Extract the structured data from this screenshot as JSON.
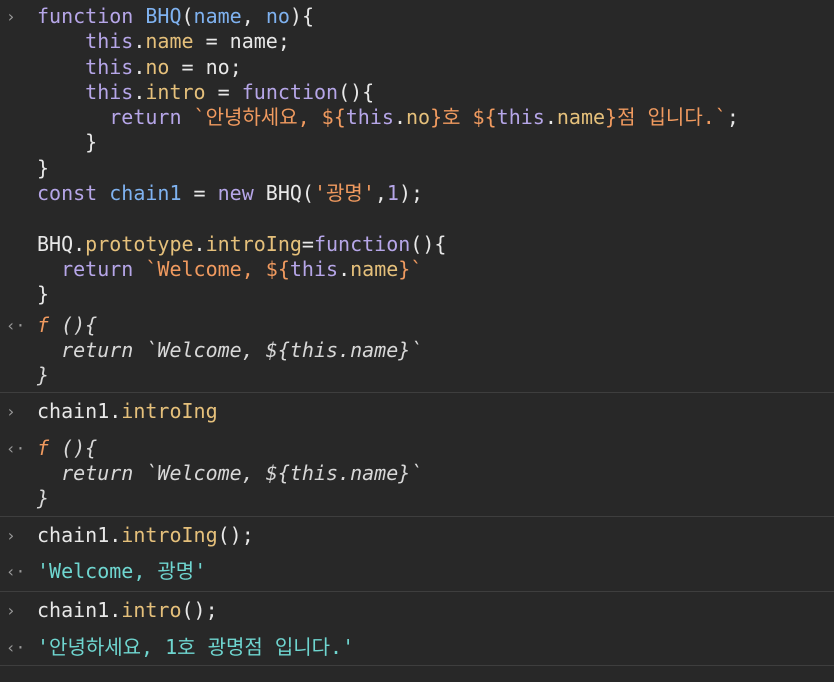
{
  "input_block_1": {
    "lines": [
      [
        "function",
        " ",
        "BHQ",
        "(",
        "name",
        ", ",
        "no",
        "){"
      ],
      [
        "    ",
        "this",
        ".",
        "name",
        " = name;"
      ],
      [
        "    ",
        "this",
        ".",
        "no",
        " = no;"
      ],
      [
        "    ",
        "this",
        ".",
        "intro",
        " = ",
        "function",
        "(){"
      ],
      [
        "      ",
        "return",
        " ",
        "`안녕하세요, ${",
        "this",
        ".",
        "no",
        "}호 ${",
        "this",
        ".",
        "name",
        "}점 입니다.`",
        ";"
      ],
      [
        "    }"
      ],
      [
        "}"
      ],
      [
        "const",
        " ",
        "chain1",
        " = ",
        "new",
        " BHQ(",
        "'광명'",
        ",",
        "1",
        ");"
      ],
      [
        ""
      ],
      [
        "BHQ.",
        "prototype",
        ".",
        "introIng",
        "=",
        "function",
        "(){"
      ],
      [
        "  ",
        "return",
        " ",
        "`Welcome, ${",
        "this",
        ".",
        "name",
        "}`"
      ],
      [
        "}"
      ]
    ]
  },
  "output_block_1": {
    "l1_f": "f",
    "l1_rest": " (){",
    "l2": "  return `Welcome, ${this.name}`",
    "l3": "}"
  },
  "input_block_2": {
    "obj": "chain1",
    "dot": ".",
    "prop": "introIng"
  },
  "output_block_2": {
    "l1_f": "f",
    "l1_rest": " (){",
    "l2": "  return `Welcome, ${this.name}`",
    "l3": "}"
  },
  "input_block_3": {
    "obj": "chain1",
    "dot": ".",
    "prop": "introIng",
    "tail": "();"
  },
  "output_block_3": {
    "value": "'Welcome, 광명'"
  },
  "input_block_4": {
    "obj": "chain1",
    "dot": ".",
    "prop": "intro",
    "tail": "();"
  },
  "output_block_4": {
    "value": "'안녕하세요, 1호 광명점 입니다.'"
  },
  "markers": {
    "input": "›",
    "output": "‹·"
  },
  "colors": {
    "background": "#282828",
    "keyword": "#b6a6e8",
    "identifier": "#7fb2f0",
    "property": "#e5c07b",
    "string": "#f09a5f",
    "result_string": "#6fd6d0"
  }
}
